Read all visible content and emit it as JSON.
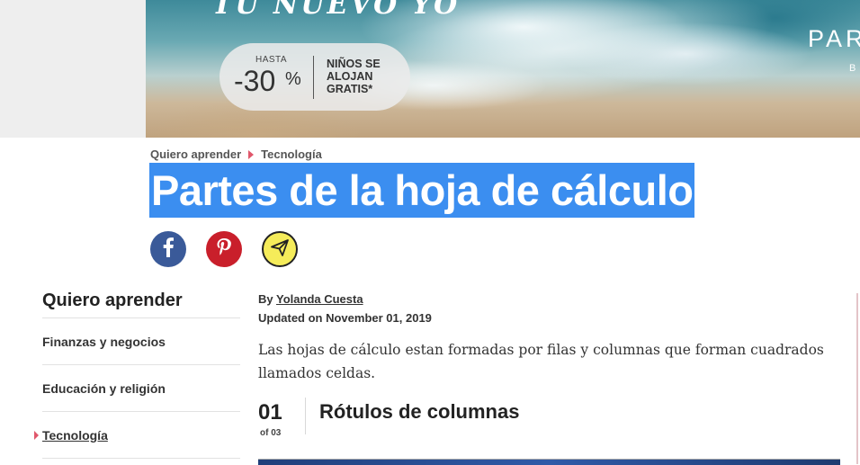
{
  "ad": {
    "headline": "TU NUEVO YO",
    "upto": "HASTA",
    "discount": "-30",
    "percent": "%",
    "kids_text": "NIÑOS SE ALOJAN GRATIS*",
    "brand": "PARA",
    "brand_sub": "B"
  },
  "breadcrumb": {
    "items": [
      "Quiero aprender",
      "Tecnología"
    ]
  },
  "article": {
    "title": "Partes de la hoja de cálculo",
    "byline_prefix": "By",
    "author": "Yolanda Cuesta",
    "updated": "Updated on November 01, 2019",
    "intro": "Las hojas de cálculo estan formadas por filas y columnas que forman cuadrados llamados celdas.",
    "step": {
      "number": "01",
      "of": "of 03",
      "title": "Rótulos de columnas"
    }
  },
  "share": {
    "icons": [
      "facebook-icon",
      "pinterest-icon",
      "send-email-icon"
    ]
  },
  "sidebar": {
    "title": "Quiero aprender",
    "items": [
      {
        "label": "Finanzas y negocios"
      },
      {
        "label": "Educación y religión"
      },
      {
        "label": "Tecnología"
      }
    ]
  },
  "colors": {
    "accent": "#e0576b",
    "selection": "#3b8ef0",
    "facebook": "#3a5a99",
    "pinterest": "#c91f2b",
    "email": "#f5ec5a"
  }
}
